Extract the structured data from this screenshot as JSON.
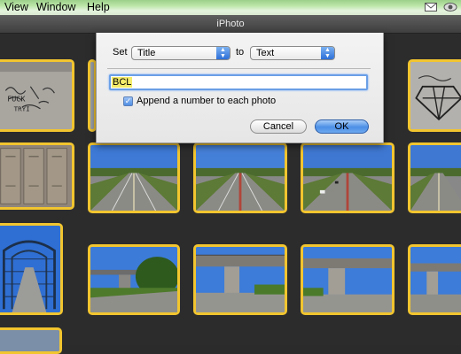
{
  "menubar": {
    "items": [
      {
        "label": "View"
      },
      {
        "label": "Window"
      },
      {
        "label": "Help"
      }
    ],
    "tray_icons": [
      "mail-icon",
      "eye-icon"
    ]
  },
  "window": {
    "title": "iPhoto"
  },
  "dialog": {
    "set_label": "Set",
    "field_value": "Title",
    "to_label": "to",
    "type_value": "Text",
    "text_value": "BCL",
    "append_label": "Append a number to each photo",
    "append_checked": true,
    "cancel_label": "Cancel",
    "ok_label": "OK"
  },
  "accent": {
    "selection_border": "#f2c52f",
    "ok_blue": "#4b8fe6"
  },
  "photos": [
    {
      "kind": "graffiti-wall"
    },
    {
      "kind": "blank"
    },
    {
      "kind": "diamond-graffiti"
    },
    {
      "kind": "lockers"
    },
    {
      "kind": "highway"
    },
    {
      "kind": "highway"
    },
    {
      "kind": "highway"
    },
    {
      "kind": "highway"
    },
    {
      "kind": "highway"
    },
    {
      "kind": "walkway-tunnel"
    },
    {
      "kind": "overpass"
    },
    {
      "kind": "overpass"
    },
    {
      "kind": "overpass"
    },
    {
      "kind": "overpass"
    },
    {
      "kind": "partial"
    }
  ]
}
